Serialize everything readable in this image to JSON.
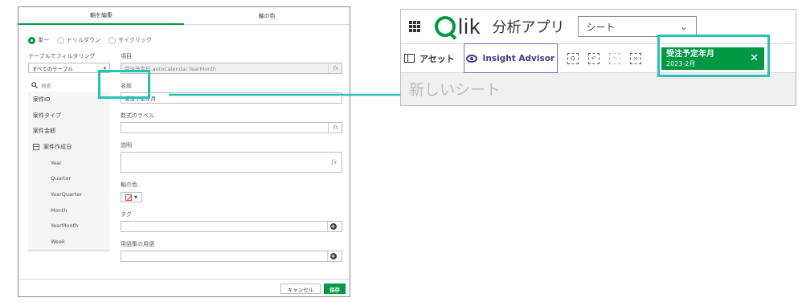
{
  "dialog": {
    "tabs": [
      "軸を編集",
      "軸の色"
    ],
    "radio_options": [
      "単一",
      "ドリルダウン",
      "サイクリック"
    ],
    "filter_label": "テーブルでフィルタリング",
    "table_select": "すべてのテーブル",
    "search_placeholder": "検索",
    "fields": [
      {
        "label": "案件ID",
        "sub": false,
        "calendar": false
      },
      {
        "label": "案件タイプ",
        "sub": false,
        "calendar": false
      },
      {
        "label": "案件金額",
        "sub": false,
        "calendar": false
      },
      {
        "label": "案件作成日",
        "sub": false,
        "calendar": true
      },
      {
        "label": "Year",
        "sub": true,
        "calendar": false
      },
      {
        "label": "Quarter",
        "sub": true,
        "calendar": false
      },
      {
        "label": "YearQuarter",
        "sub": true,
        "calendar": false
      },
      {
        "label": "Month",
        "sub": true,
        "calendar": false
      },
      {
        "label": "YearMonth",
        "sub": true,
        "calendar": false
      },
      {
        "label": "Week",
        "sub": true,
        "calendar": false
      }
    ],
    "item_label": "項目",
    "item_value": "受注予定日.autoCalendar.YearMonth",
    "name_label": "名前",
    "name_value": "受注予定年月",
    "expr_label": "数式のラベル",
    "desc_label": "説明",
    "color_label": "軸の色",
    "tag_label": "タグ",
    "glossary_label": "用語集の用語",
    "fx": "fx",
    "cancel": "キャンセル",
    "save": "保存",
    "accent": "#009845"
  },
  "qlik": {
    "logo_text": "lik",
    "app_title": "分析アプリ",
    "sheet_select": "シート",
    "assets": "アセット",
    "insight_advisor": "Insight Advisor",
    "selection_title": "受注予定年月",
    "selection_value": "2023-2月",
    "new_sheet": "新しいシート",
    "highlight_color": "#27c1b7"
  }
}
